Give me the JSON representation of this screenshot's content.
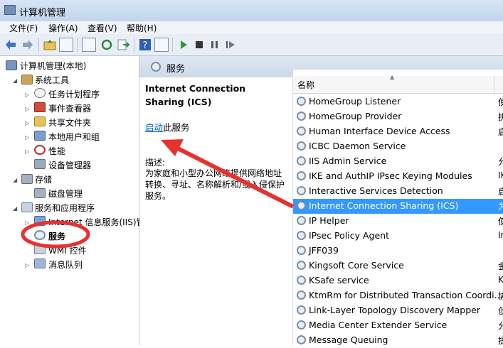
{
  "window": {
    "title": "计算机管理"
  },
  "menu": [
    "文件(F)",
    "操作(A)",
    "查看(V)",
    "帮助(H)"
  ],
  "tree": {
    "root": "计算机管理(本地)",
    "system_tools": "系统工具",
    "task_scheduler": "任务计划程序",
    "event_viewer": "事件查看器",
    "shared_folders": "共享文件夹",
    "local_users": "本地用户和组",
    "performance": "性能",
    "device_manager": "设备管理器",
    "storage": "存储",
    "disk_management": "磁盘管理",
    "services_apps": "服务和应用程序",
    "iis": "Internet 信息服务(IIS)管",
    "services": "服务",
    "wmi": "WMI 控件",
    "message_queue": "消息队列"
  },
  "panel": {
    "header": "服务",
    "service_title": "Internet Connection Sharing (ICS)",
    "start_link": "启动",
    "start_suffix": "此服务",
    "desc_label": "描述:",
    "desc_text": "为家庭和小型办公网络提供网络地址转换、寻址、名称解析和/或入侵保护服务。"
  },
  "list": {
    "col_name": "名称",
    "rows": [
      {
        "name": "HomeGroup Listener",
        "desc": "使"
      },
      {
        "name": "HomeGroup Provider",
        "desc": "执"
      },
      {
        "name": "Human Interface Device Access",
        "desc": "启"
      },
      {
        "name": "ICBC Daemon Service",
        "desc": ""
      },
      {
        "name": "IIS Admin Service",
        "desc": "允"
      },
      {
        "name": "IKE and AuthIP IPsec Keying Modules",
        "desc": "IK"
      },
      {
        "name": "Interactive Services Detection",
        "desc": "启"
      },
      {
        "name": "Internet Connection Sharing (ICS)",
        "desc": "为"
      },
      {
        "name": "IP Helper",
        "desc": "使"
      },
      {
        "name": "IPsec Policy Agent",
        "desc": "In"
      },
      {
        "name": "JFF039",
        "desc": ""
      },
      {
        "name": "Kingsoft Core Service",
        "desc": "金"
      },
      {
        "name": "KSafe service",
        "desc": "K"
      },
      {
        "name": "KtmRm for Distributed Transaction Coordi...",
        "desc": "协"
      },
      {
        "name": "Link-Layer Topology Discovery Mapper",
        "desc": "创"
      },
      {
        "name": "Media Center Extender Service",
        "desc": "允"
      },
      {
        "name": "Message Queuing",
        "desc": "提"
      }
    ],
    "selected_index": 7
  },
  "colors": {
    "selection": "#3399ff",
    "annotation": "#e8312f",
    "link": "#0066cc"
  }
}
